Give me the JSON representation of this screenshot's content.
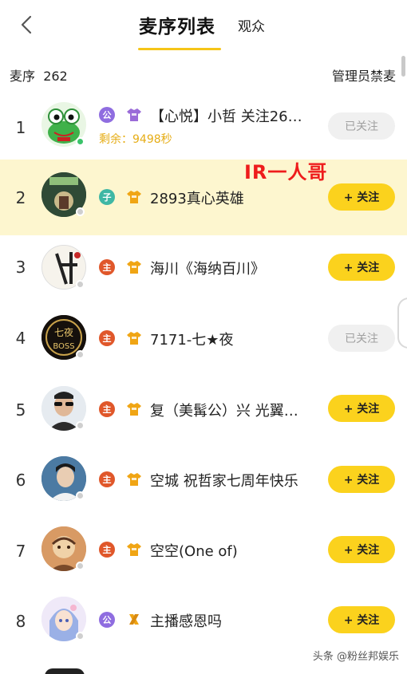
{
  "header": {
    "tab_active": "麦序列表",
    "tab_other": "观众",
    "accent": "#f5c518"
  },
  "meta": {
    "queue_label": "麦序",
    "queue_count": "262",
    "admin_ban": "管理员禁麦"
  },
  "annotation": "IR一人哥",
  "rows": [
    {
      "index": "1",
      "badge": "公",
      "name": "【心悦】小哲  关注26…",
      "sub": "剩余：9498秒",
      "button": "已关注",
      "followed": true,
      "online": true
    },
    {
      "index": "2",
      "badge": "子",
      "name": "2893真心英雄",
      "button": "+ 关注",
      "followed": false,
      "online": false,
      "highlight": true
    },
    {
      "index": "3",
      "badge": "主",
      "name": "海川《海纳百川》",
      "button": "+ 关注",
      "followed": false,
      "online": false
    },
    {
      "index": "4",
      "badge": "主",
      "name": "7171-七★夜",
      "button": "已关注",
      "followed": true,
      "online": false
    },
    {
      "index": "5",
      "badge": "主",
      "name": "复（美髯公）兴  光翼…",
      "button": "+ 关注",
      "followed": false,
      "online": false
    },
    {
      "index": "6",
      "badge": "主",
      "name": "空城 祝哲家七周年快乐",
      "button": "+ 关注",
      "followed": false,
      "online": false
    },
    {
      "index": "7",
      "badge": "主",
      "name": "空空(One of)",
      "button": "+ 关注",
      "followed": false,
      "online": false
    },
    {
      "index": "8",
      "badge": "公",
      "name": "主播感恩吗",
      "button": "+ 关注",
      "followed": false,
      "online": false
    }
  ],
  "watermark": "头条 @粉丝邦娱乐"
}
